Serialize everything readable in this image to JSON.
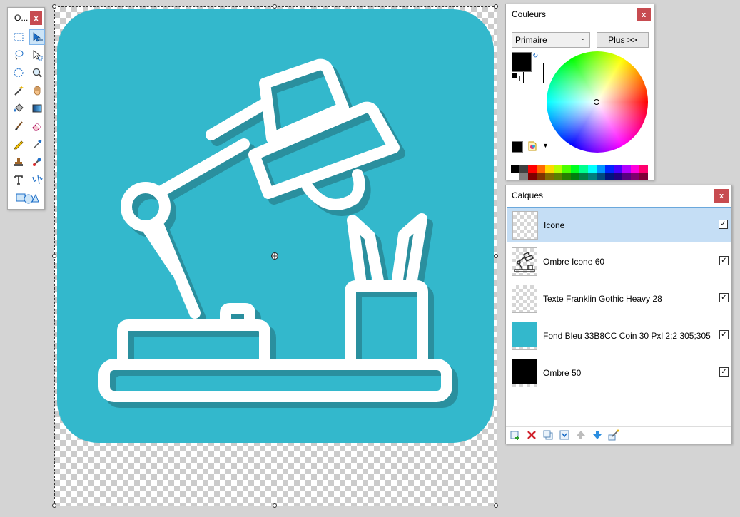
{
  "toolbox": {
    "title": "O...",
    "close": "x",
    "tools": [
      {
        "name": "rectangle-select-tool-icon",
        "active": false
      },
      {
        "name": "move-selection-tool-icon",
        "active": true
      },
      {
        "name": "lasso-select-tool-icon",
        "active": false
      },
      {
        "name": "move-selected-tool-icon",
        "active": false
      },
      {
        "name": "ellipse-select-tool-icon",
        "active": false
      },
      {
        "name": "zoom-tool-icon",
        "active": false
      },
      {
        "name": "magic-wand-tool-icon",
        "active": false
      },
      {
        "name": "pan-tool-icon",
        "active": false
      },
      {
        "name": "paint-bucket-tool-icon",
        "active": false
      },
      {
        "name": "gradient-tool-icon",
        "active": false
      },
      {
        "name": "paintbrush-tool-icon",
        "active": false
      },
      {
        "name": "eraser-tool-icon",
        "active": false
      },
      {
        "name": "pencil-tool-icon",
        "active": false
      },
      {
        "name": "color-picker-tool-icon",
        "active": false
      },
      {
        "name": "clone-stamp-tool-icon",
        "active": false
      },
      {
        "name": "recolor-tool-icon",
        "active": false
      },
      {
        "name": "text-tool-icon",
        "active": false
      },
      {
        "name": "line-curve-tool-icon",
        "active": false
      },
      {
        "name": "shapes-tool-icon",
        "active": false
      }
    ]
  },
  "colors": {
    "title": "Couleurs",
    "close": "x",
    "mode": "Primaire",
    "more_button": "Plus >>",
    "primary_color": "#000000",
    "secondary_color": "#ffffff",
    "palette_top": [
      "#000000",
      "#404040",
      "#ff0000",
      "#ff6a00",
      "#ffd800",
      "#b6ff00",
      "#4cff00",
      "#00ff21",
      "#00ff90",
      "#00ffff",
      "#0094ff",
      "#0026ff",
      "#4800ff",
      "#b200ff",
      "#ff00dc",
      "#ff006e"
    ],
    "palette_bottom": [
      "#ffffff",
      "#808080",
      "#7f0000",
      "#7f3300",
      "#7f6a00",
      "#5b7f00",
      "#267f00",
      "#007f0e",
      "#007f46",
      "#007f7f",
      "#004a7f",
      "#00137f",
      "#21007f",
      "#57007f",
      "#7f006e",
      "#7f0037"
    ]
  },
  "layers": {
    "title": "Calques",
    "close": "x",
    "items": [
      {
        "name": "Icone",
        "visible": true,
        "selected": true,
        "thumb": "transparent"
      },
      {
        "name": "Ombre Icone 60",
        "visible": true,
        "selected": false,
        "thumb": "shadow"
      },
      {
        "name": "Texte Franklin Gothic Heavy 28",
        "visible": true,
        "selected": false,
        "thumb": "transparent"
      },
      {
        "name": "Fond Bleu 33B8CC Coin 30 Pxl 2;2 305;305",
        "visible": true,
        "selected": false,
        "thumb": "blue"
      },
      {
        "name": "Ombre 50",
        "visible": true,
        "selected": false,
        "thumb": "black"
      }
    ],
    "footer_icons": [
      "add-layer-icon",
      "delete-layer-icon",
      "duplicate-layer-icon",
      "merge-layer-down-icon",
      "move-layer-up-icon",
      "move-layer-down-icon",
      "layer-properties-icon"
    ]
  },
  "artwork": {
    "background_color": "#33b8cc",
    "shadow_color": "#2a8f9e",
    "stroke_color": "#ffffff"
  }
}
